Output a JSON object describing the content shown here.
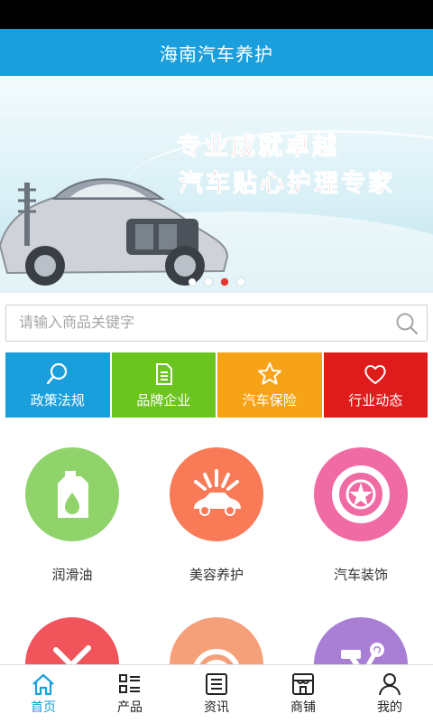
{
  "app": {
    "title": "海南汽车养护"
  },
  "banner": {
    "slogan_line1": "专业成就卓越",
    "slogan_line2": "汽车贴心护理专家",
    "slide_count": 4,
    "active_slide": 3
  },
  "search": {
    "placeholder": "请输入商品关键字",
    "icon": "search-icon"
  },
  "quick_links": [
    {
      "label": "政策法规",
      "icon": "search-icon",
      "color": "#1a9fdc"
    },
    {
      "label": "品牌企业",
      "icon": "document-icon",
      "color": "#6cc51f"
    },
    {
      "label": "汽车保险",
      "icon": "star-icon",
      "color": "#f7a318"
    },
    {
      "label": "行业动态",
      "icon": "heart-icon",
      "color": "#e01b1b"
    }
  ],
  "categories": [
    {
      "label": "润滑油",
      "icon": "oil-bottle-icon",
      "color": "#8fd36a"
    },
    {
      "label": "美容养护",
      "icon": "car-wash-icon",
      "color": "#f97a56"
    },
    {
      "label": "汽车装饰",
      "icon": "tire-icon",
      "color": "#f06aa4"
    },
    {
      "label": "",
      "icon": "tools-icon",
      "color": "#f2545b"
    },
    {
      "label": "",
      "icon": "signal-icon",
      "color": "#f6a07a"
    },
    {
      "label": "",
      "icon": "hammer-wrench-icon",
      "color": "#a97fd6"
    }
  ],
  "tabbar": [
    {
      "label": "首页",
      "icon": "home-icon",
      "active": true
    },
    {
      "label": "产品",
      "icon": "grid-list-icon",
      "active": false
    },
    {
      "label": "资讯",
      "icon": "news-icon",
      "active": false
    },
    {
      "label": "商铺",
      "icon": "shop-icon",
      "active": false
    },
    {
      "label": "我的",
      "icon": "user-icon",
      "active": false
    }
  ],
  "colors": {
    "accent": "#1a9fdc",
    "status_bar": "#000000",
    "slogan_red": "#e8322d"
  }
}
